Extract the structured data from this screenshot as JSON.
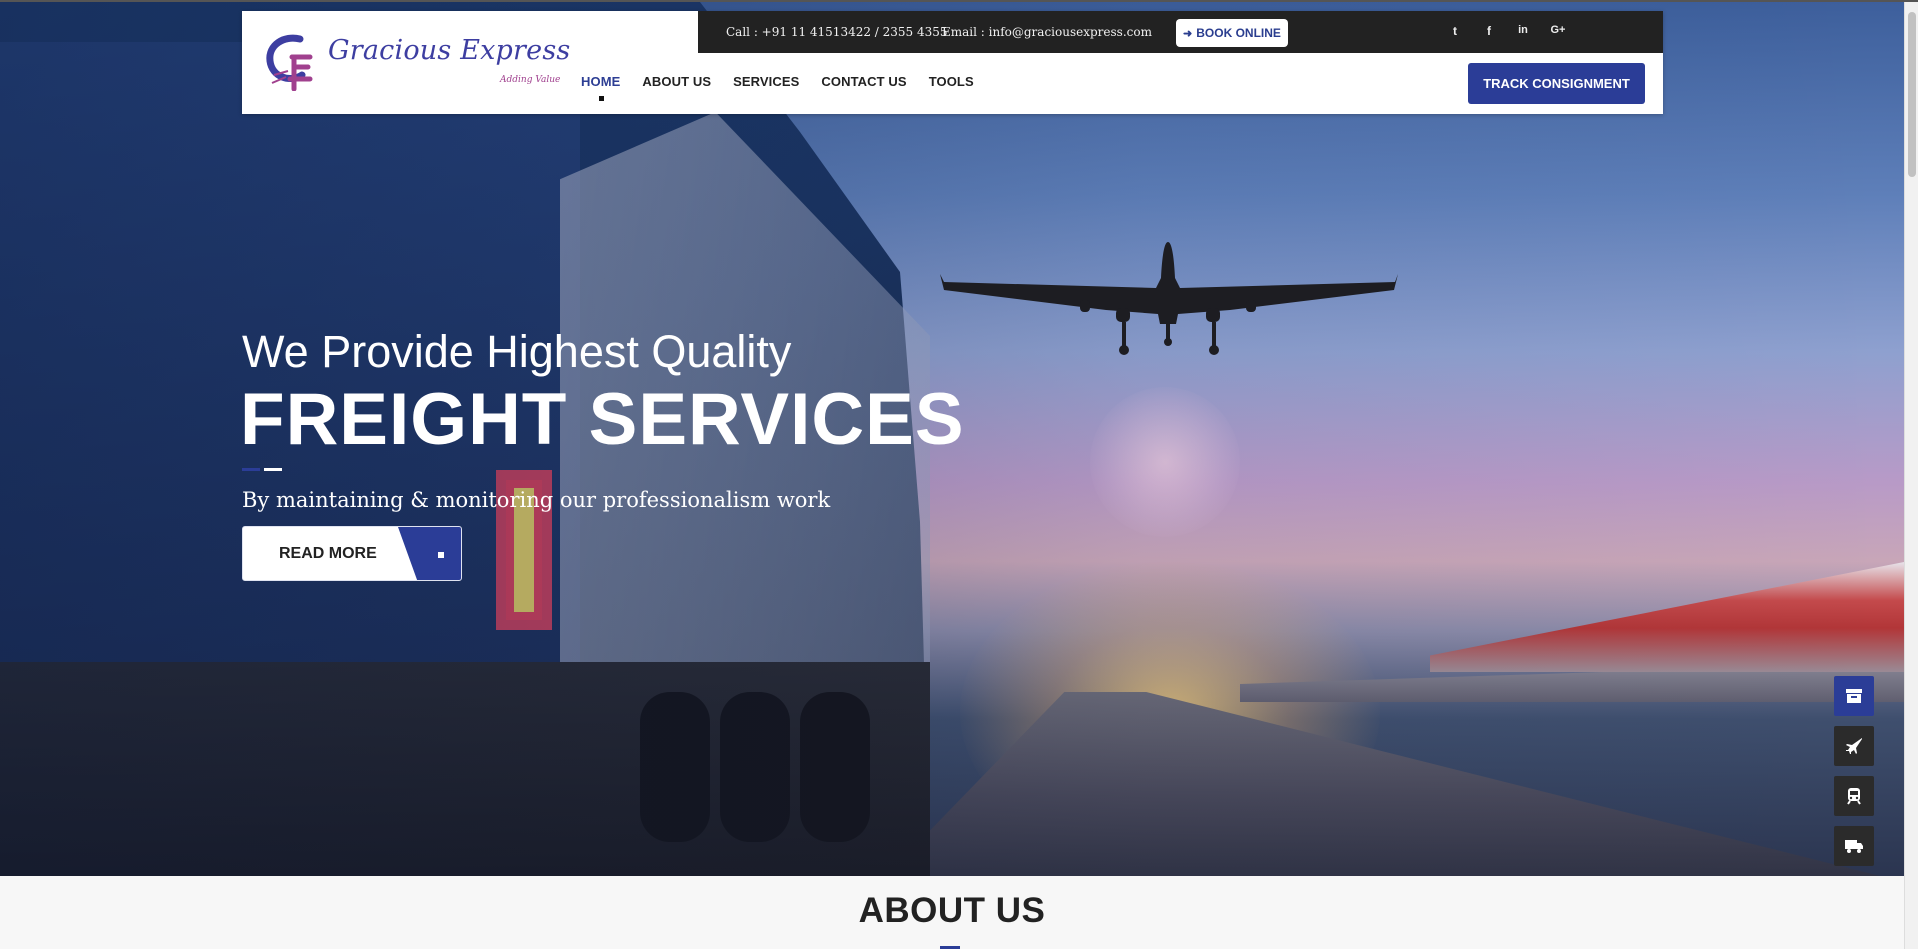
{
  "brand": {
    "name": "Gracious Express",
    "tagline": "Adding Value",
    "colors": {
      "primary": "#2b3d97",
      "logo_text": "#3d3ea1",
      "logo_accent": "#a0408e",
      "topbar": "#222222"
    }
  },
  "topbar": {
    "call": "Call : +91 11 41513422 / 2355 4355",
    "email": "Email :  info@graciousexpress.com",
    "book_label": "BOOK ONLINE",
    "social": [
      {
        "name": "twitter-icon",
        "glyph": "t"
      },
      {
        "name": "facebook-icon",
        "glyph": "f"
      },
      {
        "name": "linkedin-icon",
        "glyph": "in"
      },
      {
        "name": "google-plus-icon",
        "glyph": "G+"
      }
    ]
  },
  "nav": {
    "items": [
      {
        "label": "HOME",
        "active": true
      },
      {
        "label": "ABOUT US"
      },
      {
        "label": "SERVICES"
      },
      {
        "label": "CONTACT US"
      },
      {
        "label": "TOOLS"
      }
    ],
    "track_label": "TRACK CONSIGNMENT"
  },
  "hero": {
    "subtitle": "We Provide Highest Quality",
    "title": "FREIGHT SERVICES",
    "description": "By maintaining & monitoring our professionalism work",
    "button_label": "READ MORE"
  },
  "side_buttons": [
    {
      "name": "package-icon"
    },
    {
      "name": "plane-icon"
    },
    {
      "name": "train-icon"
    },
    {
      "name": "truck-icon"
    }
  ],
  "about": {
    "title": "ABOUT US"
  }
}
